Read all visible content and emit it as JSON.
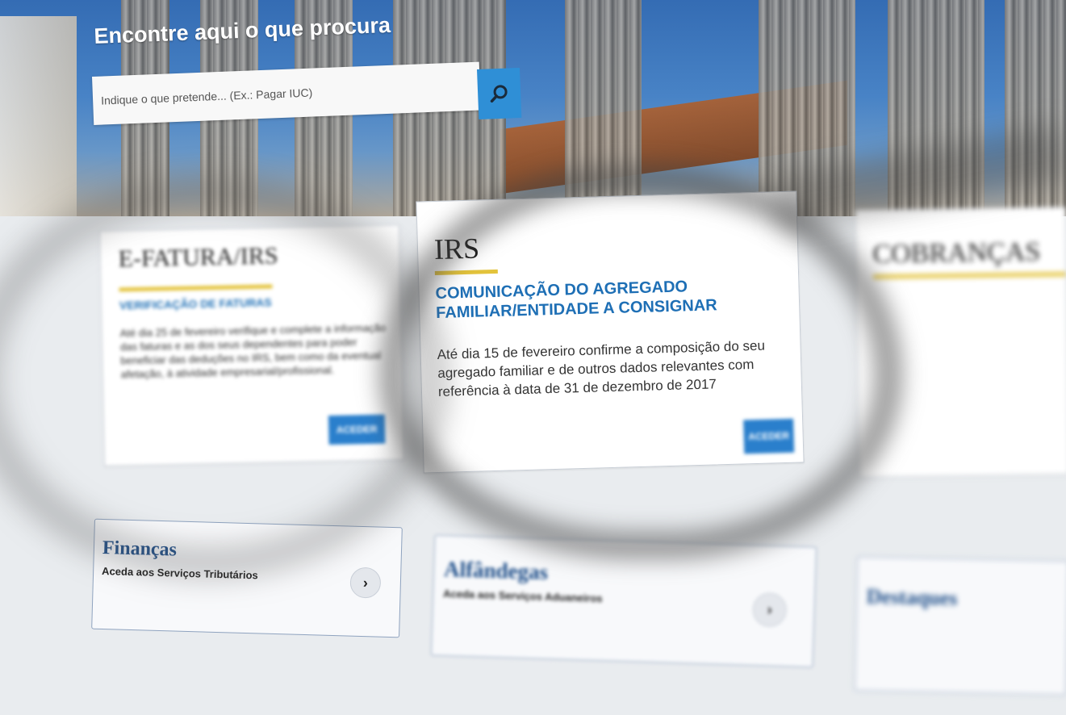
{
  "hero": {
    "title": "Encontre aqui o que procura",
    "search_placeholder": "Indique o que pretende... (Ex.: Pagar IUC)",
    "search_icon": "search-icon"
  },
  "cards": {
    "efatura": {
      "title": "E-FATURA/IRS",
      "subtitle": "VERIFICAÇÃO DE FATURAS",
      "body": "Até dia 25 de fevereiro verifique e complete a informação das faturas e as dos seus dependentes para poder beneficiar das deduções no IRS, bem como da eventual afetação, à atividade empresarial/profissional.",
      "button": "ACEDER"
    },
    "irs": {
      "title": "IRS",
      "subtitle": "COMUNICAÇÃO DO AGREGADO FAMILIAR/ENTIDADE A CONSIGNAR",
      "body": "Até dia 15 de fevereiro confirme a composição do seu agregado familiar e de outros dados relevantes com referência à data de 31 de dezembro de 2017",
      "button": "ACEDER"
    },
    "cobrancas": {
      "title": "COBRANÇAS",
      "subtitle": "",
      "body": ""
    }
  },
  "links": {
    "financas": {
      "title": "Finanças",
      "desc": "Aceda aos Serviços Tributários",
      "arrow": "›"
    },
    "alfandegas": {
      "title": "Alfândegas",
      "desc": "Aceda aos Serviços Aduaneiros",
      "arrow": "›"
    },
    "destaques": {
      "title": "Destaques",
      "desc": ""
    }
  },
  "colors": {
    "accent_blue": "#2a7fcc",
    "underline_yellow": "#e3c33b",
    "link_title_blue": "#1f4f8a"
  }
}
